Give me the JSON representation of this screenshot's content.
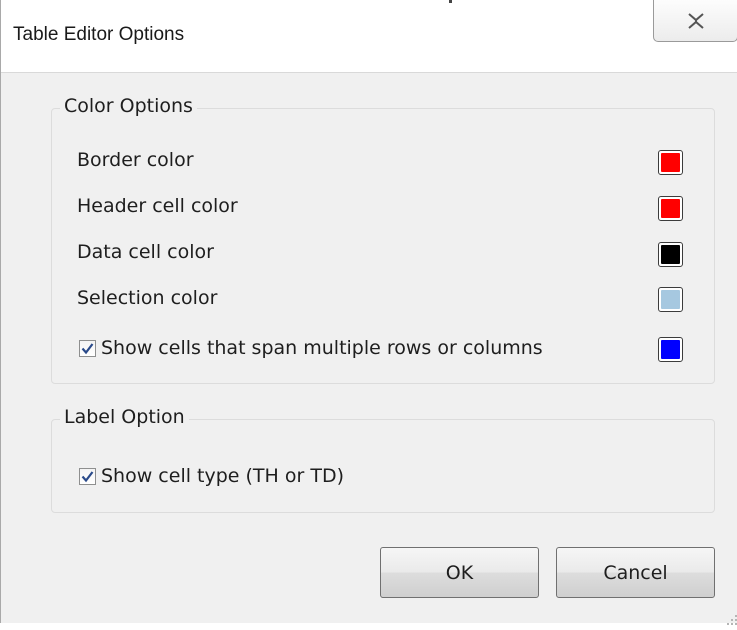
{
  "window": {
    "title": "Table Editor Options"
  },
  "color_options": {
    "legend": "Color Options",
    "rows": [
      {
        "label": "Border color",
        "color": "#ff0000"
      },
      {
        "label": "Header cell color",
        "color": "#ff0000"
      },
      {
        "label": "Data cell color",
        "color": "#000000"
      },
      {
        "label": "Selection color",
        "color": "#a6c8e0"
      }
    ],
    "span_row": {
      "label": "Show cells that span multiple rows or columns",
      "checked": true,
      "color": "#0000ff"
    }
  },
  "label_option": {
    "legend": "Label Option",
    "check": {
      "label": "Show cell type (TH or TD)",
      "checked": true
    }
  },
  "buttons": {
    "ok_label": "OK",
    "cancel_label": "Cancel"
  },
  "icons": {
    "close": "close-icon",
    "checkmark": "checkmark-icon",
    "resize": "resize-grip-icon"
  }
}
